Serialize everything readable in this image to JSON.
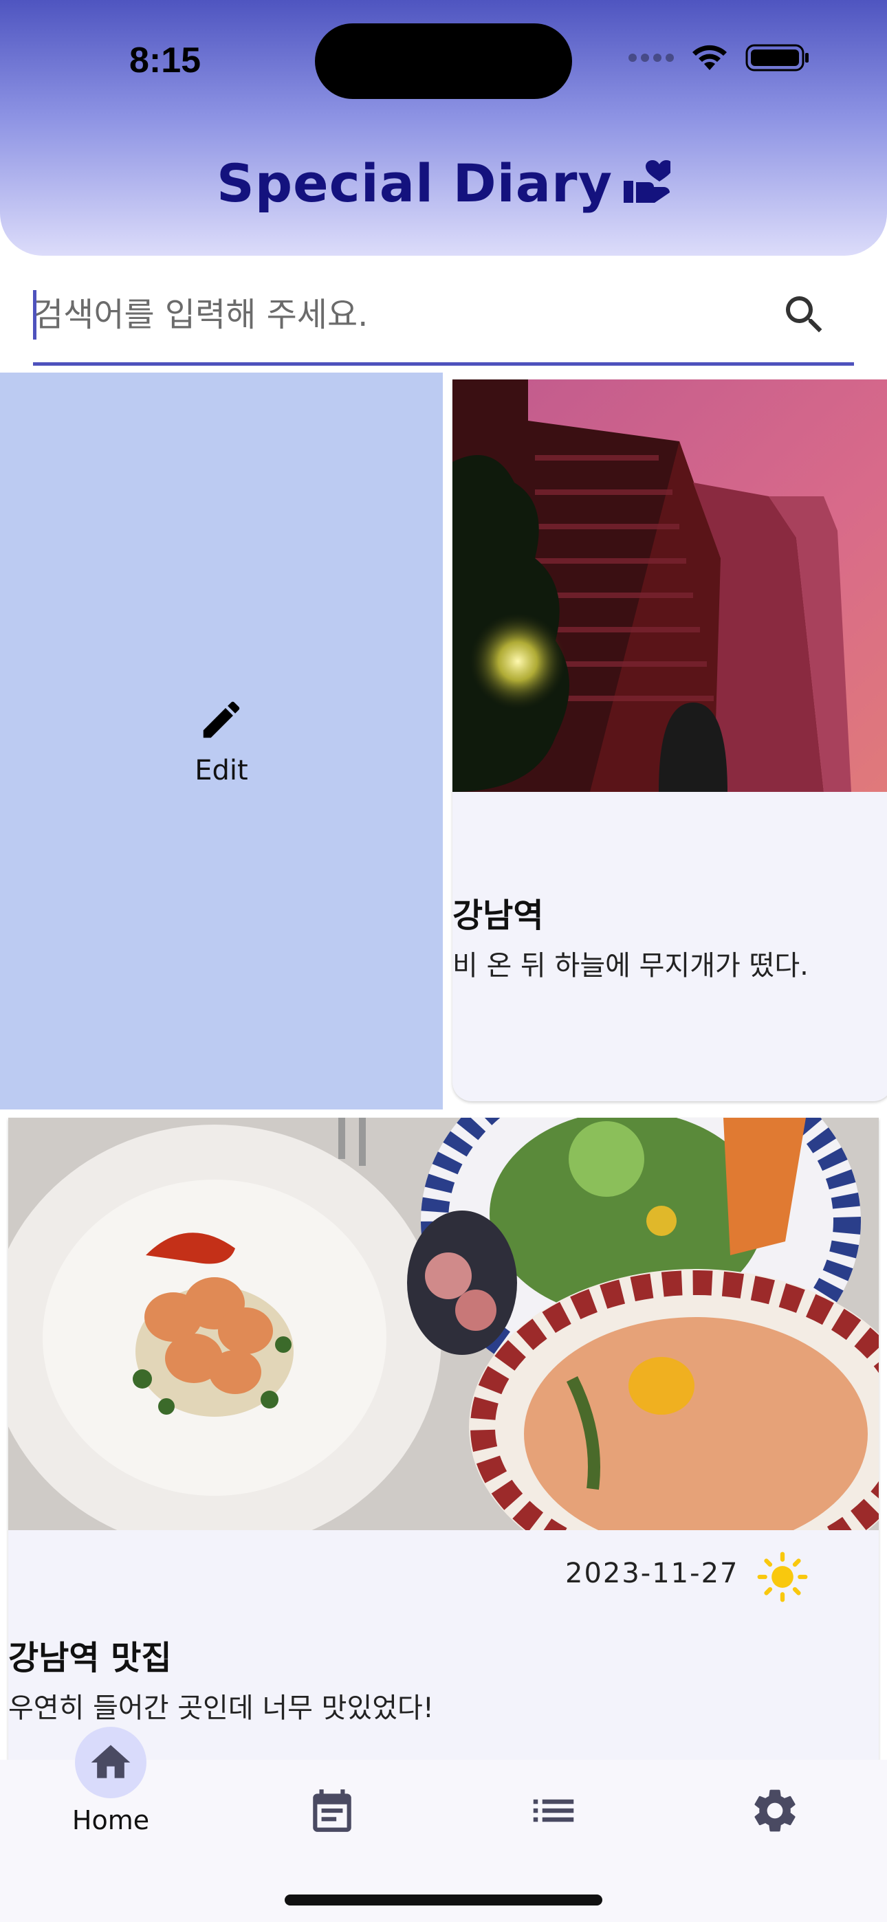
{
  "status_bar": {
    "time": "8:15"
  },
  "app": {
    "title": "Special Diary"
  },
  "search": {
    "placeholder": "검색어를 입력해 주세요."
  },
  "edit_tile": {
    "label": "Edit"
  },
  "cards": [
    {
      "title": "강남역",
      "body": "비 온 뒤 하늘에 무지개가 떴다."
    },
    {
      "date": "2023-11-27",
      "weather_icon": "sun-icon",
      "title": "강남역 맛집",
      "body": "우연히 들어간 곳인데 너무 맛있었다!"
    }
  ],
  "nav": {
    "items": [
      {
        "label": "Home",
        "icon": "home-icon",
        "active": true
      },
      {
        "label": "",
        "icon": "calendar-icon",
        "active": false
      },
      {
        "label": "",
        "icon": "list-icon",
        "active": false
      },
      {
        "label": "",
        "icon": "gear-icon",
        "active": false
      }
    ]
  },
  "colors": {
    "header_top": "#4f55c0",
    "header_bottom": "#dcdcfa",
    "title": "#14127e",
    "accent": "#4e52bd",
    "edit_tile": "#bccbf2",
    "sun": "#f9c80e"
  }
}
